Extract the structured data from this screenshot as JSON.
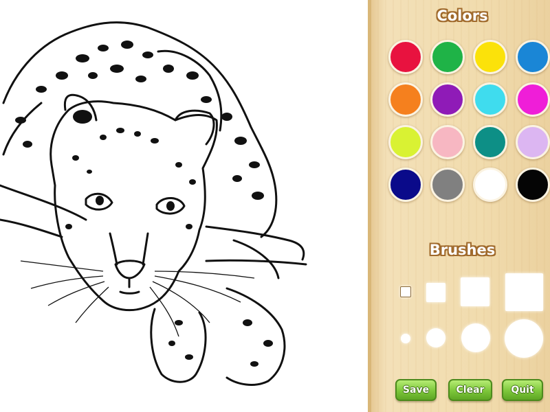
{
  "panel": {
    "colors_title": "Colors",
    "brushes_title": "Brushes"
  },
  "palette": [
    {
      "name": "red",
      "hex": "#e8123f"
    },
    {
      "name": "green",
      "hex": "#1fb347"
    },
    {
      "name": "yellow",
      "hex": "#fbe20a"
    },
    {
      "name": "blue",
      "hex": "#1a86d6"
    },
    {
      "name": "orange",
      "hex": "#f5801e"
    },
    {
      "name": "purple",
      "hex": "#8f1bb7"
    },
    {
      "name": "cyan",
      "hex": "#3fdcee"
    },
    {
      "name": "magenta",
      "hex": "#ef1ed8"
    },
    {
      "name": "lime",
      "hex": "#d9f233"
    },
    {
      "name": "pink",
      "hex": "#f7b7c2"
    },
    {
      "name": "teal",
      "hex": "#0d8f86"
    },
    {
      "name": "lavender",
      "hex": "#dcb6f2"
    },
    {
      "name": "navy",
      "hex": "#0a0a8a"
    },
    {
      "name": "gray",
      "hex": "#808080"
    },
    {
      "name": "white",
      "hex": "#ffffff"
    },
    {
      "name": "black",
      "hex": "#050505"
    }
  ],
  "brushes": {
    "square": [
      "tiny",
      "small",
      "medium",
      "large"
    ],
    "round": [
      "tiny",
      "small",
      "medium",
      "large"
    ],
    "selected": "square-tiny"
  },
  "buttons": {
    "save": "Save",
    "clear": "Clear",
    "quit": "Quit",
    "color": "#7cc63a"
  },
  "canvas": {
    "subject": "leopard-outline"
  }
}
